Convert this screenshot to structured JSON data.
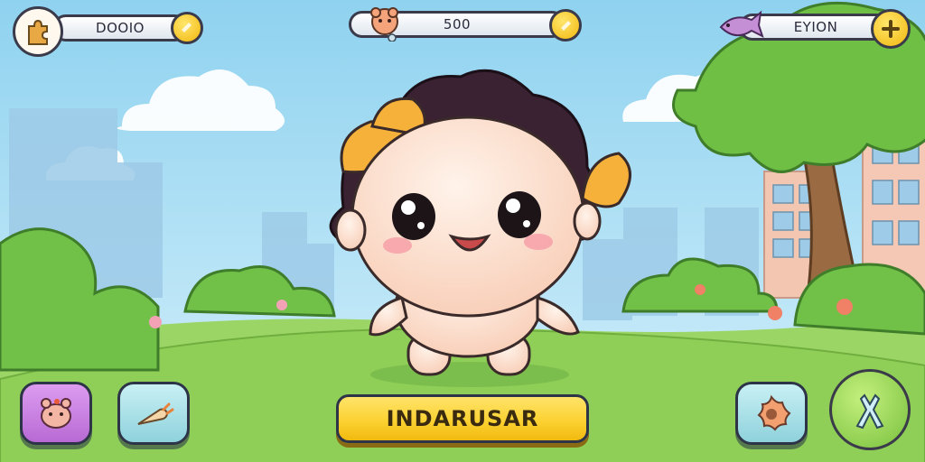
{
  "hud": {
    "left_value": "DOOIO",
    "center_value": "500",
    "right_value": "EYION"
  },
  "action_button": {
    "label": "INDARUSAR"
  },
  "icons": {
    "top_left": "puzzle-icon",
    "left_add": "coin-add-icon",
    "center_pet": "pet-face-icon",
    "center_coin": "coin-icon",
    "right_fish": "fish-icon",
    "right_add": "plus-icon",
    "btn1": "pet-icon",
    "btn2": "carrot-icon",
    "btn3": "flower-icon",
    "btn4": "brush-icon"
  },
  "colors": {
    "sky": "#a9dcf3",
    "grass": "#8fcf58",
    "accent_yellow": "#fbd232",
    "purple_button": "#c77ee0",
    "teal_button": "#9fdce4",
    "green_button": "#8fd65a"
  }
}
